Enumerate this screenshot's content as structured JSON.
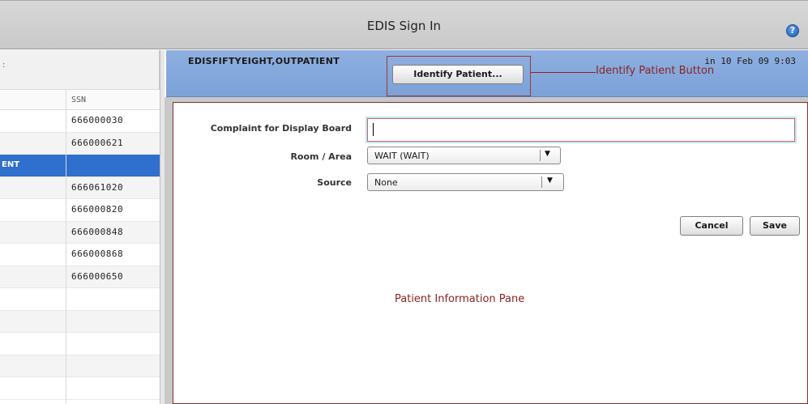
{
  "window": {
    "title": "EDIS Sign In",
    "help_icon": "question-circle-icon"
  },
  "patient_list": {
    "top_fragment": ":",
    "column_ssn": "SSN",
    "rows": [
      {
        "name": "",
        "ssn": "666000030"
      },
      {
        "name": "",
        "ssn": "666000621"
      },
      {
        "name": "ENT",
        "ssn": "",
        "selected": true
      },
      {
        "name": "",
        "ssn": "666061020"
      },
      {
        "name": "",
        "ssn": "666000820"
      },
      {
        "name": "",
        "ssn": "666000848"
      },
      {
        "name": "",
        "ssn": "666000868"
      },
      {
        "name": "",
        "ssn": "666000650"
      },
      {
        "name": "",
        "ssn": ""
      },
      {
        "name": "",
        "ssn": ""
      },
      {
        "name": "",
        "ssn": ""
      },
      {
        "name": "",
        "ssn": ""
      },
      {
        "name": "",
        "ssn": ""
      }
    ]
  },
  "patient_header": {
    "name": "EDISFIFTYEIGHT,OUTPATIENT",
    "date": "in 10 Feb 09 9:03",
    "identify_button": "Identify Patient...",
    "callout": "Identify Patient Button"
  },
  "form": {
    "complaint_label": "Complaint for Display Board",
    "complaint_value": "",
    "room_label": "Room / Area",
    "room_value": "WAIT  (WAIT)",
    "source_label": "Source",
    "source_value": "None",
    "cancel": "Cancel",
    "save": "Save",
    "pane_caption": "Patient Information Pane"
  },
  "colors": {
    "selected_row": "#2f6fcd",
    "header_band": "#7ba1d8",
    "annotation": "#8a2323"
  }
}
